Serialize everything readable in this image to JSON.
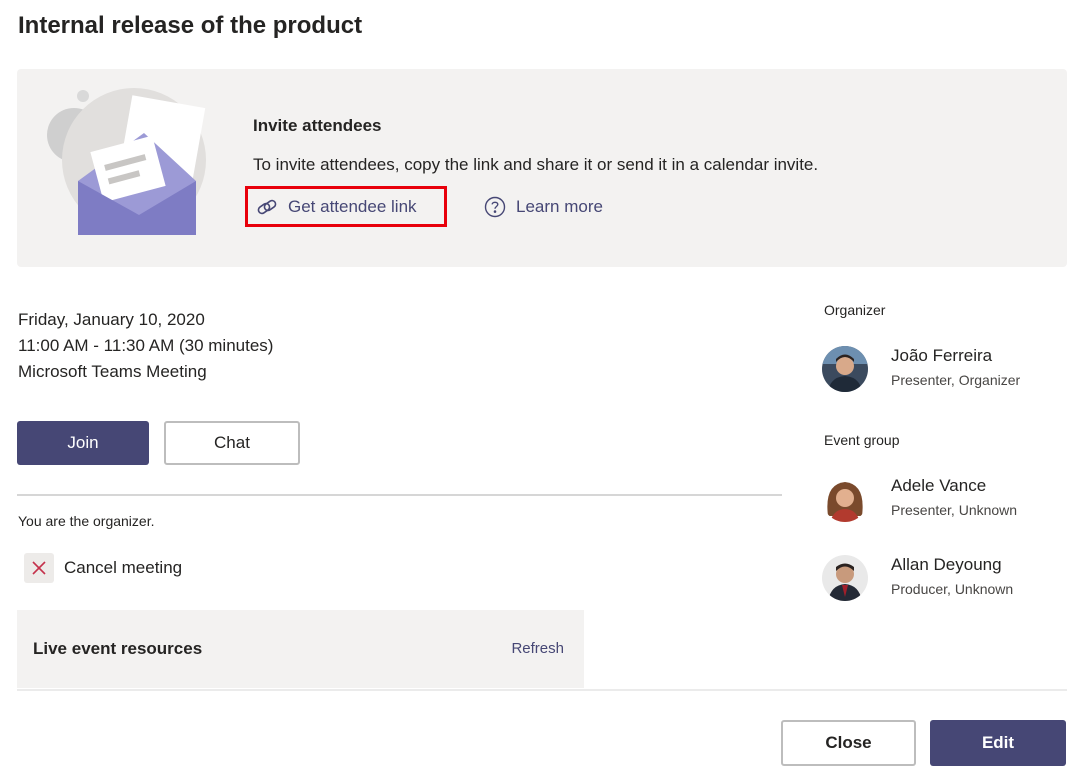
{
  "meeting": {
    "title": "Internal release of the product",
    "date": "Friday, January 10, 2020",
    "time": "11:00 AM - 11:30 AM (30 minutes)",
    "type": "Microsoft Teams Meeting"
  },
  "invite": {
    "heading": "Invite attendees",
    "description": "To invite attendees, copy the link and share it or send it in a calendar invite.",
    "attendee_link_label": "Get attendee link",
    "learn_more_label": "Learn more",
    "attendee_link_icon": "link-icon",
    "learn_more_icon": "help-circle-icon"
  },
  "actions": {
    "join_label": "Join",
    "chat_label": "Chat"
  },
  "organizer_section": {
    "note": "You are the organizer.",
    "cancel_label": "Cancel meeting",
    "cancel_icon": "close-icon"
  },
  "resources": {
    "title": "Live event resources",
    "refresh_label": "Refresh"
  },
  "sidebar": {
    "organizer_label": "Organizer",
    "organizer": {
      "name": "João Ferreira",
      "role": "Presenter, Organizer"
    },
    "event_group_label": "Event group",
    "members": [
      {
        "name": "Adele Vance",
        "role": "Presenter, Unknown"
      },
      {
        "name": "Allan Deyoung",
        "role": "Producer, Unknown"
      }
    ]
  },
  "footer": {
    "close_label": "Close",
    "edit_label": "Edit"
  },
  "colors": {
    "brand": "#464775",
    "highlight_border": "#e8000b",
    "card_bg": "#f3f2f1"
  }
}
